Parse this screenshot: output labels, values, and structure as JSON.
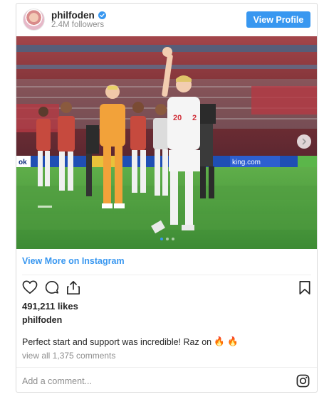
{
  "header": {
    "username": "philfoden",
    "followers": "2.4M followers",
    "view_profile": "View Profile",
    "verified_icon": "verified-badge"
  },
  "photo": {
    "ad_board_text": "ok",
    "ad_board_text_right": "king.com",
    "player_number_left": "20",
    "player_number_right": "2",
    "carousel_pages": 3,
    "carousel_active": 1
  },
  "view_more": "View More on Instagram",
  "actions": {
    "like_icon": "heart-icon",
    "comment_icon": "comment-icon",
    "share_icon": "share-icon",
    "save_icon": "bookmark-icon"
  },
  "likes": "491,211 likes",
  "poster": "philfoden",
  "caption": {
    "text": "Perfect start and support was incredible! Raz on",
    "emoji": "🔥 🔥"
  },
  "comments_link": "view all 1,375 comments",
  "comment_box": {
    "placeholder": "Add a comment...",
    "icon": "instagram-icon"
  },
  "colors": {
    "accent": "#3897f0",
    "text": "#262626",
    "muted": "#8e8e8e",
    "border": "#dbdbdb"
  }
}
